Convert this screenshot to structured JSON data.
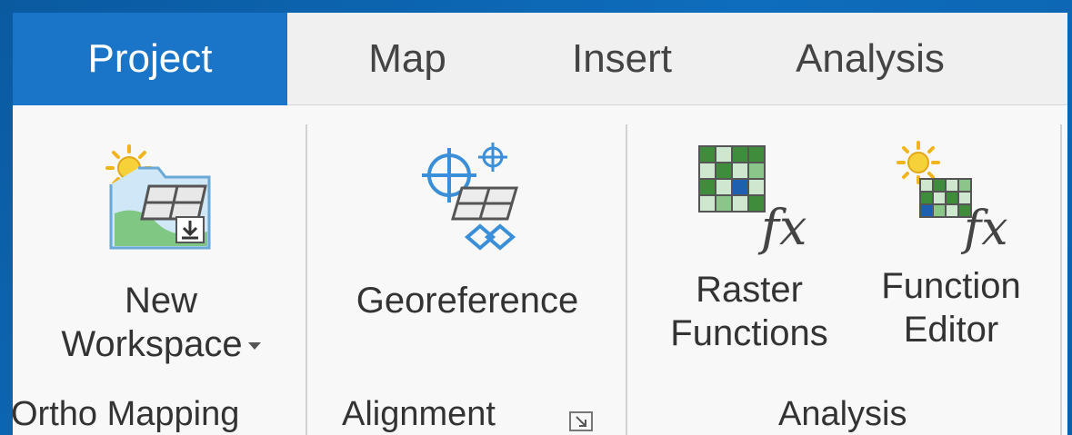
{
  "tabs": [
    {
      "label": "Project",
      "active": true
    },
    {
      "label": "Map",
      "active": false
    },
    {
      "label": "Insert",
      "active": false
    },
    {
      "label": "Analysis",
      "active": false
    }
  ],
  "groups": {
    "ortho_mapping": {
      "label": "Ortho Mapping",
      "new_workspace": {
        "line1": "New",
        "line2": "Workspace"
      }
    },
    "alignment": {
      "label": "Alignment",
      "georeference": {
        "label": "Georeference"
      }
    },
    "analysis": {
      "label": "Analysis",
      "raster_functions": {
        "line1": "Raster",
        "line2": "Functions"
      },
      "function_editor": {
        "line1": "Function",
        "line2": "Editor"
      }
    }
  },
  "colors": {
    "active_tab": "#1a75c9",
    "background": "#0b5fa8"
  },
  "icons": [
    "new-workspace-icon",
    "georeference-icon",
    "raster-functions-icon",
    "function-editor-icon",
    "dialog-launcher-icon",
    "dropdown-caret-icon"
  ]
}
